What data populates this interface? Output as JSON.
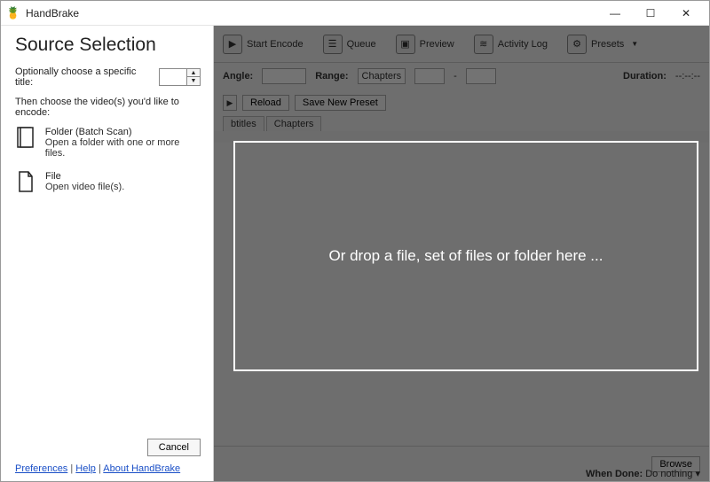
{
  "window": {
    "title": "HandBrake"
  },
  "winControls": {
    "minimize": "—",
    "maximize": "☐",
    "close": "✕"
  },
  "leftPane": {
    "heading": "Source Selection",
    "specificTitleLabel": "Optionally choose a specific title:",
    "specificTitleValue": "",
    "instruction": "Then choose the video(s) you'd like to encode:",
    "folderOption": {
      "title": "Folder (Batch Scan)",
      "subtitle": "Open a folder with one or more files."
    },
    "fileOption": {
      "title": "File",
      "subtitle": "Open video file(s)."
    },
    "cancel": "Cancel",
    "links": {
      "preferences": "Preferences",
      "help": "Help",
      "about": "About HandBrake",
      "sep": " | "
    }
  },
  "toolbar": {
    "startEncode": "Start Encode",
    "queue": "Queue",
    "preview": "Preview",
    "activityLog": "Activity Log",
    "presets": "Presets"
  },
  "row2": {
    "angle": "Angle:",
    "range": "Range:",
    "rangeMode": "Chapters",
    "dash": "-",
    "duration": "Duration:",
    "durationValue": "--:--:--"
  },
  "row3": {
    "reload": "Reload",
    "savePreset": "Save New Preset"
  },
  "tabs": {
    "subtitles": "btitles",
    "chapters": "Chapters"
  },
  "dropZone": {
    "text": "Or drop a file, set of files or folder here ..."
  },
  "bottom": {
    "browse": "Browse",
    "whenDoneLabel": "When Done:",
    "whenDoneValue": "Do nothing ▾"
  }
}
